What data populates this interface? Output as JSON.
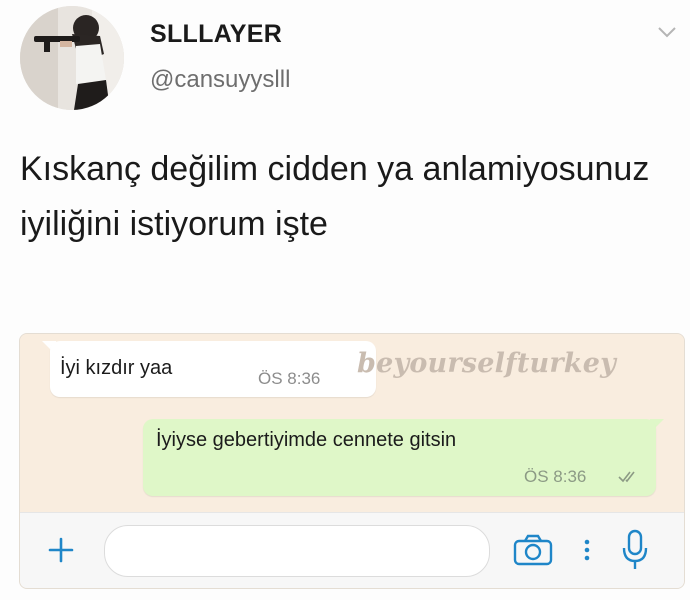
{
  "tweet": {
    "display_name": "SLLLAYER",
    "handle": "@cansuyyslll",
    "text": "Kıskanç değilim cidden ya anlamiyosunuz iyiliğini istiyorum işte"
  },
  "chat": {
    "incoming": {
      "text": "İyi kızdır yaa",
      "time": "ÖS 8:36"
    },
    "outgoing": {
      "text": "İyiyse gebertiyimde cennete gitsin",
      "time": "ÖS 8:36",
      "status": "read"
    },
    "watermark": "beyourselfturkey",
    "input": {
      "placeholder": ""
    }
  },
  "icons": [
    "chevron-down-icon",
    "plus-icon",
    "camera-icon",
    "more-dots-icon",
    "microphone-icon",
    "double-check-icon"
  ],
  "colors": {
    "chat_background": "#f9eddf",
    "incoming_bubble": "#ffffff",
    "outgoing_bubble": "#dff7c8",
    "icon_blue": "#1f86c8",
    "watermark": "#c9bcb0"
  }
}
